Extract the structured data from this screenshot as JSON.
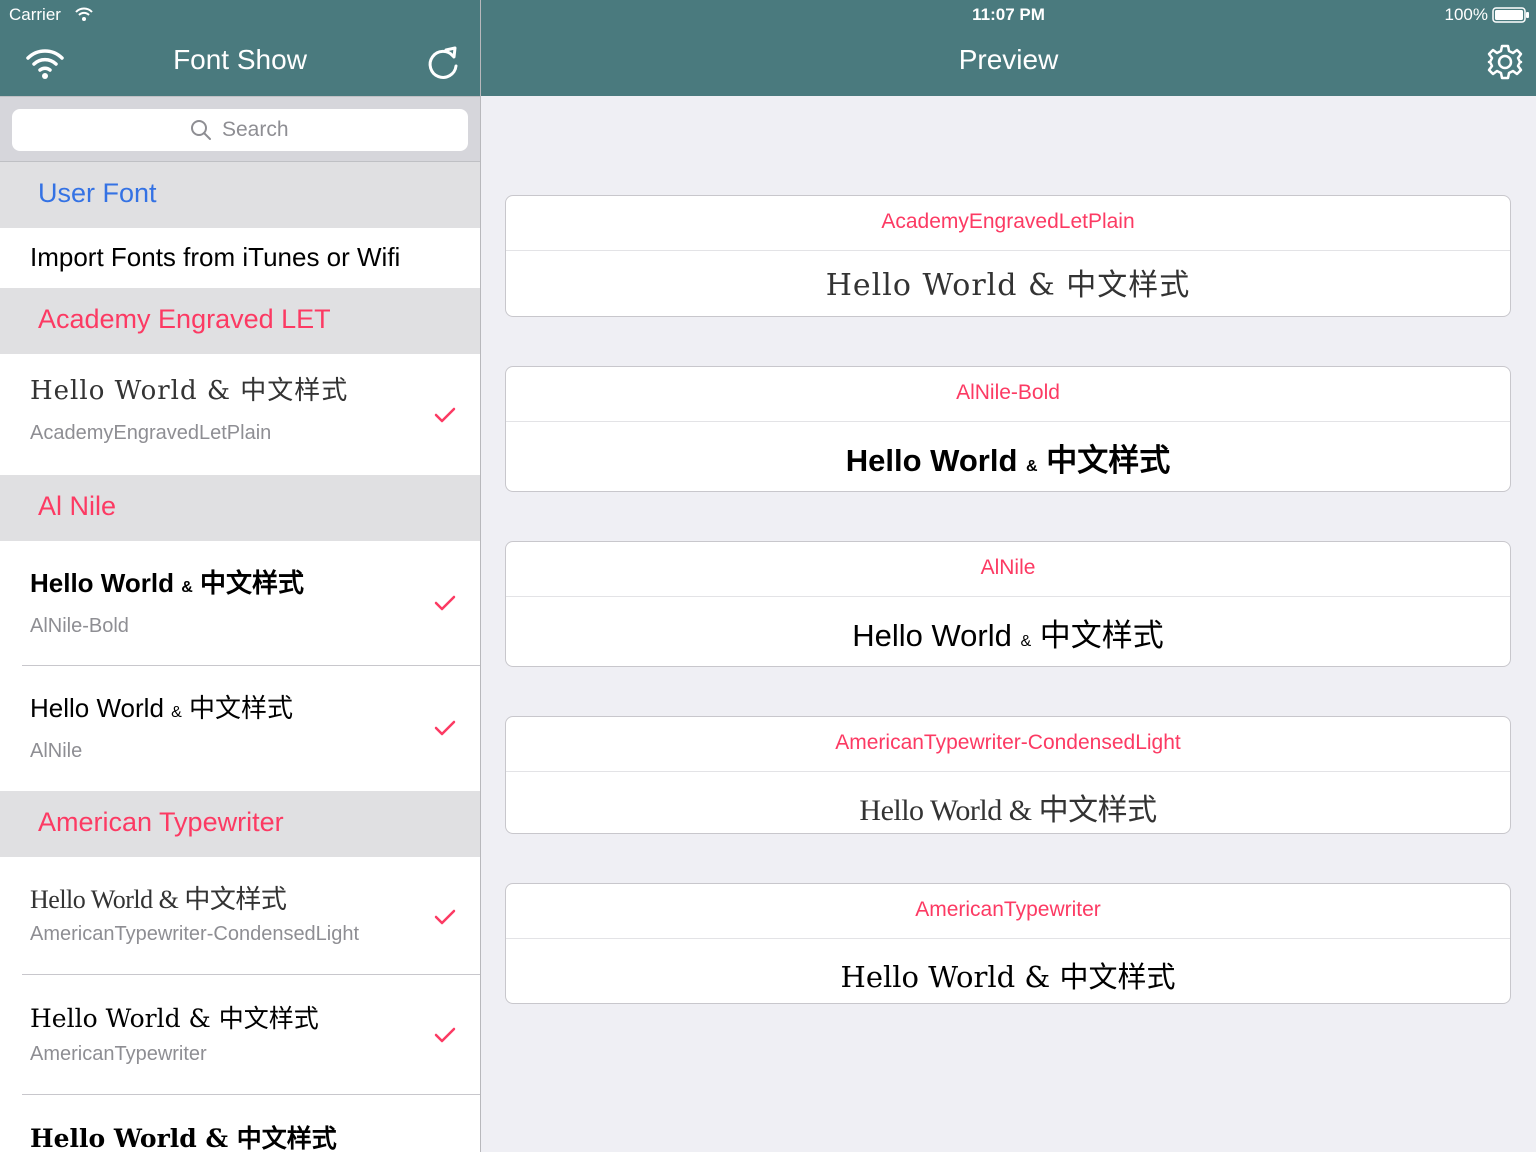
{
  "status_bar": {
    "carrier": "Carrier",
    "time": "11:07 PM",
    "battery": "100%"
  },
  "master": {
    "title": "Font Show",
    "search_placeholder": "Search",
    "user_font_header": "User Font",
    "import_label": "Import Fonts from iTunes or Wifi",
    "sections": [
      {
        "header": "Academy Engraved LET",
        "rows": [
          {
            "sample": "Hello World & 中文样式",
            "font": "AcademyEngravedLetPlain",
            "checked": true
          }
        ]
      },
      {
        "header": "Al Nile",
        "rows": [
          {
            "sample": "Hello World",
            "amp": "&",
            "cjk": "中文样式",
            "font": "AlNile-Bold",
            "checked": true
          },
          {
            "sample": "Hello World",
            "amp": "&",
            "cjk": "中文样式",
            "font": "AlNile",
            "checked": true
          }
        ]
      },
      {
        "header": "American Typewriter",
        "rows": [
          {
            "sample": "Hello World & 中文样式",
            "font": "AmericanTypewriter-CondensedLight",
            "checked": true
          },
          {
            "sample": "Hello World & 中文样式",
            "font": "AmericanTypewriter",
            "checked": true
          },
          {
            "sample": "Hello World & 中文样式"
          }
        ]
      }
    ]
  },
  "detail": {
    "title": "Preview",
    "cards": [
      {
        "font": "AcademyEngravedLetPlain",
        "sample": "Hello World & 中文样式"
      },
      {
        "font": "AlNile-Bold",
        "sample": "Hello World",
        "amp": "&",
        "cjk": "中文样式"
      },
      {
        "font": "AlNile",
        "sample": "Hello World",
        "amp": "&",
        "cjk": "中文样式"
      },
      {
        "font": "AmericanTypewriter-CondensedLight",
        "sample": "Hello World & 中文样式"
      },
      {
        "font": "AmericanTypewriter",
        "sample": "Hello World & 中文样式"
      }
    ]
  },
  "colors": {
    "nav_bar": "#4a7a7e",
    "accent_pink": "#fc3a63",
    "accent_blue": "#3472e4",
    "section_bg": "#e0e0e2",
    "detail_bg": "#efeff4"
  },
  "icons": {
    "wifi_button": "wifi-icon",
    "refresh_button": "refresh-icon",
    "settings_button": "gear-icon",
    "search": "search-icon",
    "row_check": "checkmark-icon"
  }
}
